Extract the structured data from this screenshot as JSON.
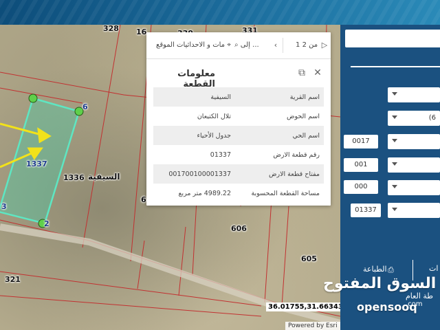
{
  "map": {
    "parcel_labels": [
      "328",
      "16",
      "330",
      "331",
      "1337",
      "1336",
      "6",
      "606",
      "605",
      "321",
      "3",
      "2",
      "6"
    ],
    "place_label": "السيفية",
    "coordinates": "36.01755,31.66343",
    "attribution": "Powered by Esri"
  },
  "popup": {
    "pager": "من 2 1",
    "zoom_label": "... إلى",
    "action_label": "مات و الاحداثيات الموقع",
    "title": "معلومات القطعة",
    "rows": [
      {
        "key": "اسم القرية",
        "value": "السيفية"
      },
      {
        "key": "اسم الحوض",
        "value": "تلال الكتيعان"
      },
      {
        "key": "اسم الحي",
        "value": "جدول الأحياء"
      },
      {
        "key": "رقم قطعة الارض",
        "value": "01337"
      },
      {
        "key": "مفتاح قطعة الارض",
        "value": "001700100001337"
      },
      {
        "key": "مساحة القطعة المحسوبة",
        "value": "4989.22 متر مربع"
      }
    ]
  },
  "panel": {
    "select_partial": "(6",
    "fields": [
      "0017",
      "001",
      "000",
      "01337"
    ],
    "print_label": "الطباعة",
    "right_label_partial": "ات",
    "bottom_label_partial": "طة العام"
  },
  "watermark": {
    "arabic": "السوق المفتوح",
    "latin": "opensooq",
    "suffix": ".com"
  },
  "colors": {
    "panel": "#1b5180",
    "parcel_fill": "#3fd5b0",
    "parcel_line": "#c23030",
    "vertex": "#5fd04a",
    "arrow": "#f2e21a"
  }
}
